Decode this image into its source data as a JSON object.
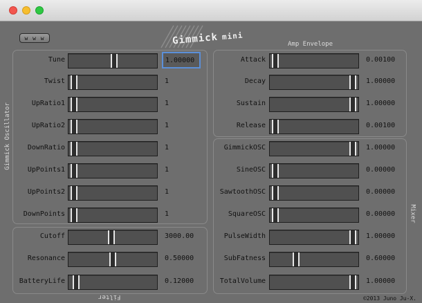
{
  "window": {
    "buttons": [
      "close",
      "minimize",
      "zoom"
    ],
    "web_button_label": "w w w",
    "logo_title": "Gimmick",
    "logo_subtitle": "mini",
    "copyright": "©2013 Juno Ju-X."
  },
  "sections": {
    "oscillator_label": "Gimmick Oscillator",
    "filter_label": "Filter",
    "amp_label": "Amp Envelope",
    "mixer_label": "Mixer"
  },
  "oscillator": [
    {
      "label": "Tune",
      "value": "1.00000",
      "level": 0.52,
      "focused": true
    },
    {
      "label": "Twist",
      "value": "1",
      "level": 0.0
    },
    {
      "label": "UpRatio1",
      "value": "1",
      "level": 0.0
    },
    {
      "label": "UpRatio2",
      "value": "1",
      "level": 0.0
    },
    {
      "label": "DownRatio",
      "value": "1",
      "level": 0.0
    },
    {
      "label": "UpPoints1",
      "value": "1",
      "level": 0.0
    },
    {
      "label": "UpPoints2",
      "value": "1",
      "level": 0.0
    },
    {
      "label": "DownPoints",
      "value": "1",
      "level": 0.0
    }
  ],
  "filter": [
    {
      "label": "Cutoff",
      "value": "3000.00",
      "level": 0.48
    },
    {
      "label": "Resonance",
      "value": "0.50000",
      "level": 0.5
    },
    {
      "label": "BatteryLife",
      "value": "0.12000",
      "level": 0.03
    }
  ],
  "amp": [
    {
      "label": "Attack",
      "value": "0.00100",
      "level": 0.0
    },
    {
      "label": "Decay",
      "value": "1.00000",
      "level": 1.0
    },
    {
      "label": "Sustain",
      "value": "1.00000",
      "level": 1.0
    },
    {
      "label": "Release",
      "value": "0.00100",
      "level": 0.0
    }
  ],
  "mixer": [
    {
      "label": "GimmickOSC",
      "value": "1.00000",
      "level": 1.0
    },
    {
      "label": "SineOSC",
      "value": "0.00000",
      "level": 0.0
    },
    {
      "label": "SawtoothOSC",
      "value": "0.00000",
      "level": 0.0
    },
    {
      "label": "SquareOSC",
      "value": "0.00000",
      "level": 0.0
    },
    {
      "label": "PulseWidth",
      "value": "1.00000",
      "level": 1.0
    },
    {
      "label": "SubFatness",
      "value": "0.60000",
      "level": 0.27
    },
    {
      "label": "TotalVolume",
      "value": "1.00000",
      "level": 1.0
    }
  ],
  "colors": {
    "background": "#6e6e6e",
    "slider_track": "#505050",
    "thumb_line": "#e6e6e6",
    "focus_ring": "#5b8fd8"
  }
}
